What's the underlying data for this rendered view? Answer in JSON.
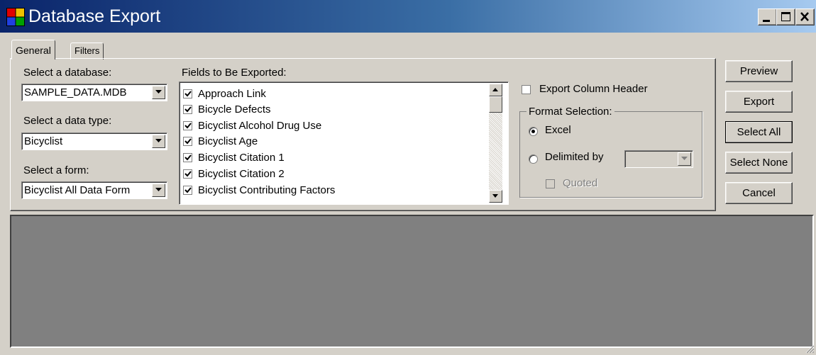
{
  "window": {
    "title": "Database Export"
  },
  "tabs": [
    {
      "label": "General"
    },
    {
      "label": "Filters"
    }
  ],
  "database": {
    "label": "Select a database:",
    "value": "SAMPLE_DATA.MDB"
  },
  "data_type": {
    "label": "Select a data type:",
    "value": "Bicyclist"
  },
  "form": {
    "label": "Select a form:",
    "value": "Bicyclist All Data Form"
  },
  "fields": {
    "label": "Fields to Be Exported:",
    "items": [
      "Approach Link",
      "Bicycle Defects",
      "Bicyclist  Alcohol Drug Use",
      "Bicyclist Age",
      "Bicyclist Citation 1",
      "Bicyclist Citation 2",
      "Bicyclist Contributing Factors"
    ]
  },
  "options": {
    "export_column_header": "Export Column Header",
    "format_group": "Format Selection:",
    "excel": "Excel",
    "delimited_by": "Delimited by",
    "quoted": "Quoted"
  },
  "buttons": {
    "preview": "Preview",
    "export": "Export",
    "select_all": "Select All",
    "select_none": "Select None",
    "cancel": "Cancel"
  }
}
